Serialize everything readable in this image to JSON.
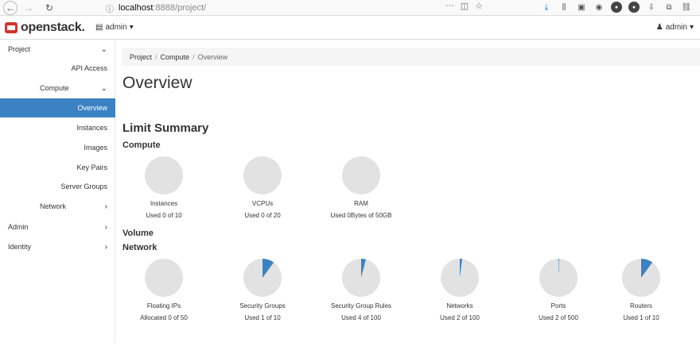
{
  "browser": {
    "url_host": "localhost",
    "url_rest": ":8888/project/",
    "url_actions": [
      "···",
      "pocket",
      "star"
    ]
  },
  "header": {
    "logo_text": "openstack.",
    "project_label": "admin",
    "user_label": "admin"
  },
  "sidebar": {
    "project": "Project",
    "api_access": "API Access",
    "compute": "Compute",
    "overview": "Overview",
    "instances": "Instances",
    "images": "Images",
    "key_pairs": "Key Pairs",
    "server_groups": "Server Groups",
    "network": "Network",
    "admin": "Admin",
    "identity": "Identity"
  },
  "breadcrumb": [
    "Project",
    "Compute",
    "Overview"
  ],
  "page_title": "Overview",
  "limit_summary": "Limit Summary",
  "groups": {
    "compute": "Compute",
    "volume": "Volume",
    "network": "Network"
  },
  "compute_limits": [
    {
      "label": "Instances",
      "used_text": "Used 0 of 10",
      "fraction": 0
    },
    {
      "label": "VCPUs",
      "used_text": "Used 0 of 20",
      "fraction": 0
    },
    {
      "label": "RAM",
      "used_text": "Used 0Bytes of 50GB",
      "fraction": 0
    }
  ],
  "network_limits": [
    {
      "label": "Floating IPs",
      "used_text": "Allocated 0 of 50",
      "fraction": 0
    },
    {
      "label": "Security Groups",
      "used_text": "Used 1 of 10",
      "fraction": 0.1
    },
    {
      "label": "Security Group Rules",
      "used_text": "Used 4 of 100",
      "fraction": 0.04
    },
    {
      "label": "Networks",
      "used_text": "Used 2 of 100",
      "fraction": 0.02
    },
    {
      "label": "Ports",
      "used_text": "Used 2 of 500",
      "fraction": 0.004
    },
    {
      "label": "Routers",
      "used_text": "Used 1 of 10",
      "fraction": 0.1
    }
  ],
  "colors": {
    "accent": "#3b82c4",
    "pie_empty": "#e2e2e2",
    "brand": "#d0342c"
  }
}
